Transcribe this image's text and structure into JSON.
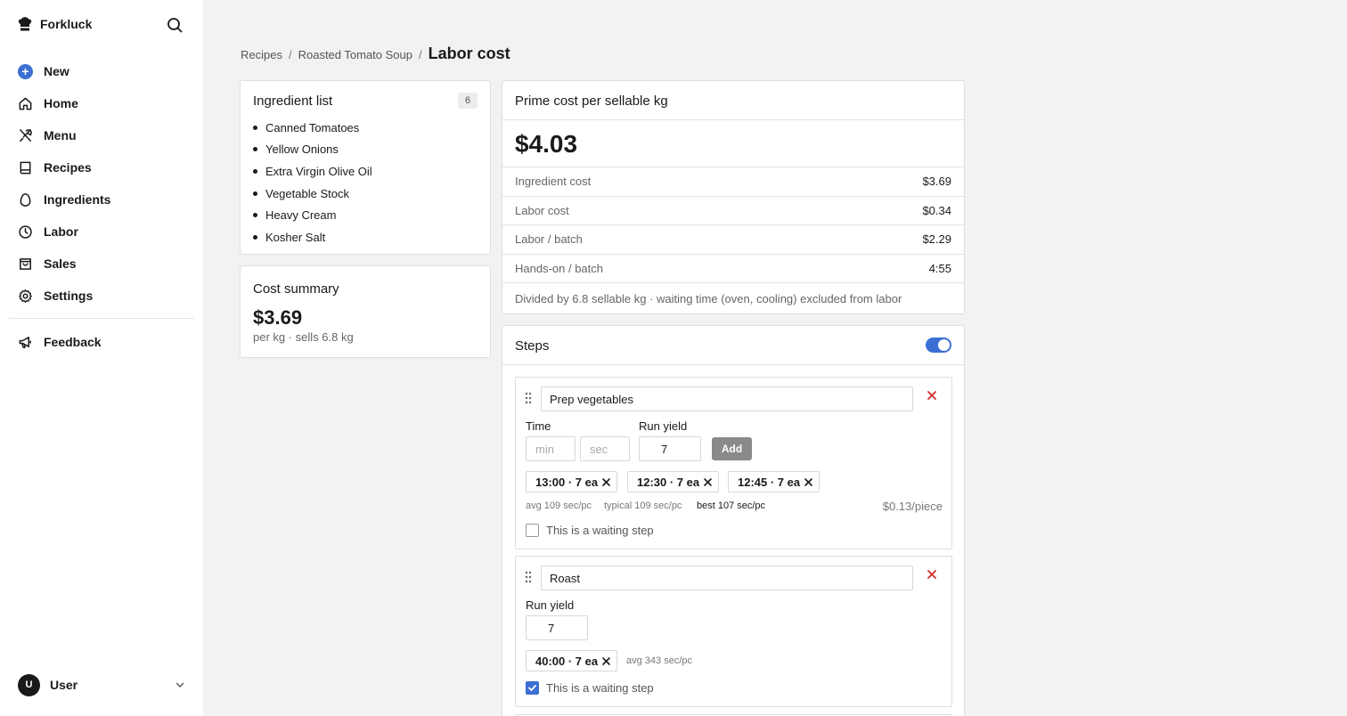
{
  "app": {
    "name": "Forkluck"
  },
  "sidebar": {
    "new_label": "New",
    "items": [
      {
        "label": "Home",
        "icon": "home-icon"
      },
      {
        "label": "Menu",
        "icon": "utensils-icon"
      },
      {
        "label": "Recipes",
        "icon": "book-icon"
      },
      {
        "label": "Ingredients",
        "icon": "egg-icon"
      },
      {
        "label": "Labor",
        "icon": "clock-icon"
      },
      {
        "label": "Sales",
        "icon": "bag-icon"
      },
      {
        "label": "Settings",
        "icon": "gear-icon"
      }
    ],
    "feedback_label": "Feedback",
    "user": {
      "initial": "U",
      "name": "User"
    }
  },
  "breadcrumb": {
    "items": [
      "Recipes",
      "Roasted Tomato Soup"
    ],
    "separator": "/",
    "current": "Labor cost"
  },
  "ingredients": {
    "title": "Ingredient list",
    "count": "6",
    "items": [
      "Canned Tomatoes",
      "Yellow Onions",
      "Extra Virgin Olive Oil",
      "Vegetable Stock",
      "Heavy Cream",
      "Kosher Salt"
    ]
  },
  "summary": {
    "title": "Cost summary",
    "amount": "$3.69",
    "note": "per kg · sells 6.8 kg"
  },
  "prime": {
    "title": "Prime cost per sellable kg",
    "amount": "$4.03",
    "rows": [
      {
        "label": "Ingredient cost",
        "value": "$3.69"
      },
      {
        "label": "Labor cost",
        "value": "$0.34"
      },
      {
        "label": "Labor / batch",
        "value": "$2.29"
      },
      {
        "label": "Hands-on / batch",
        "value": "4:55"
      }
    ],
    "footnote": "Divided by 6.8 sellable kg · waiting time (oven, cooling) excluded from labor"
  },
  "steps": {
    "title": "Steps",
    "toggle_on": true,
    "accent": "#3b6fd4",
    "list": [
      {
        "name": "Prep vegetables",
        "time_label": "Time",
        "min_placeholder": "min",
        "sec_placeholder": "sec",
        "run_yield_label": "Run yield",
        "run_yield": "7",
        "add_label": "Add",
        "runs": [
          "13:00 · 7 ea",
          "12:30 · 7 ea",
          "12:45 · 7 ea"
        ],
        "avg": "avg 109 sec/pc",
        "typical": "typical 109 sec/pc",
        "best": "best 107 sec/pc",
        "price": "$0.13/piece",
        "waiting_label": "This is a waiting step",
        "waiting": false
      },
      {
        "name": "Roast",
        "run_yield_label": "Run yield",
        "run_yield": "7",
        "runs": [
          "40:00 · 7 ea"
        ],
        "avg": "avg 343 sec/pc",
        "waiting_label": "This is a waiting step",
        "waiting": true
      }
    ]
  }
}
